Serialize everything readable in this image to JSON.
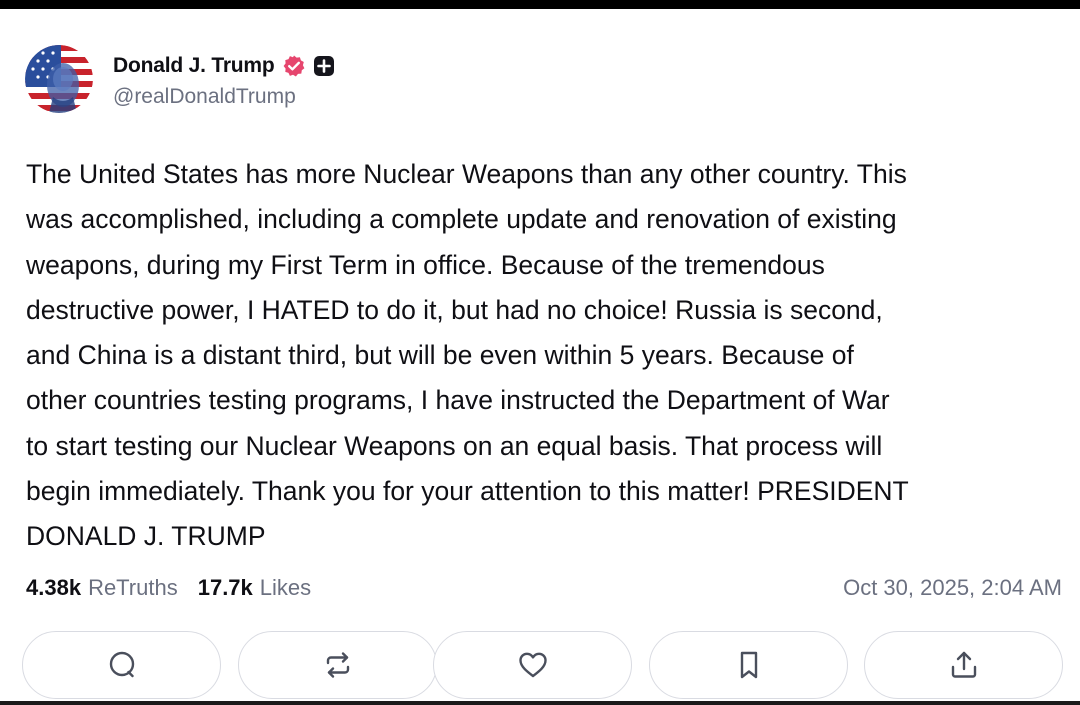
{
  "post": {
    "author": {
      "name": "Donald J. Trump",
      "handle": "@realDonaldTrump",
      "avatar_icon": "avatar-image",
      "verified_icon": "verified-badge-icon",
      "verified_color": "#e6466e",
      "plus_icon": "plus-badge-icon"
    },
    "text": "The United States has more Nuclear Weapons than any other country. This\nwas accomplished, including a complete update and renovation of existing\nweapons, during my First Term in office. Because of the tremendous\ndestructive power, I HATED to do it, but had no choice! Russia is second,\nand China is a distant third, but will be even within 5 years. Because of\nother countries testing programs, I have instructed the Department of War\nto start testing our Nuclear Weapons on an equal basis. That process will\nbegin immediately. Thank you for your attention to this matter! PRESIDENT\nDONALD J. TRUMP",
    "stats": {
      "retruths_count": "4.38k",
      "retruths_label": "ReTruths",
      "likes_count": "17.7k",
      "likes_label": "Likes"
    },
    "timestamp": "Oct 30, 2025, 2:04 AM",
    "actions": [
      {
        "icon": "reply-icon"
      },
      {
        "icon": "retruth-icon"
      },
      {
        "icon": "heart-icon"
      },
      {
        "icon": "bookmark-icon"
      },
      {
        "icon": "share-icon"
      }
    ]
  },
  "colors": {
    "text": "#0f0f14",
    "muted": "#6b7080",
    "border": "#d9dbe2",
    "icon": "#4a4f5c"
  }
}
